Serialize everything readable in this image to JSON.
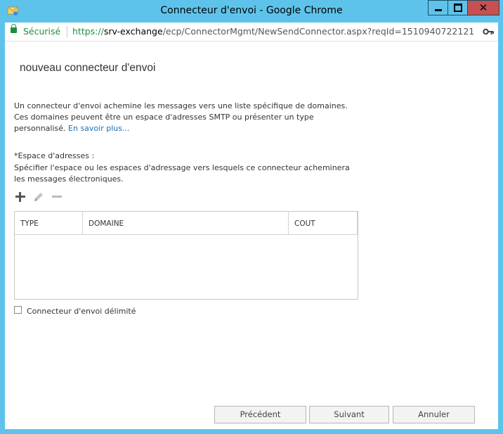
{
  "window": {
    "title": "Connecteur d'envoi - Google Chrome",
    "close_glyph": "✕"
  },
  "addressbar": {
    "secure_label": "Sécurisé",
    "url_protocol": "https://",
    "url_host": "srv-exchange",
    "url_path": "/ecp/ConnectorMgmt/NewSendConnector.aspx?reqId=1510940722121"
  },
  "page": {
    "title": "nouveau connecteur d'envoi",
    "description": "Un connecteur d'envoi achemine les messages vers une liste spécifique de domaines. Ces domaines peuvent être un espace d'adresses SMTP ou présenter un type personnalisé.",
    "learn_more": "En savoir plus...",
    "address_space_label": "*Espace d'adresses :",
    "address_space_help": "Spécifier l'espace ou les espaces d'adressage vers lesquels ce connecteur acheminera les messages électroniques."
  },
  "toolbar": {
    "icons": [
      "add-icon",
      "edit-icon",
      "remove-icon"
    ]
  },
  "grid": {
    "columns": [
      "TYPE",
      "DOMAINE",
      "COUT"
    ],
    "rows": []
  },
  "options": {
    "scoped_label": "Connecteur d'envoi délimité",
    "scoped_checked": false
  },
  "buttons": {
    "previous": "Précédent",
    "next": "Suivant",
    "cancel": "Annuler"
  },
  "colors": {
    "titlebar": "#5ec3ea",
    "close_button": "#c75050",
    "secure_green": "#1e8e3e",
    "link_blue": "#1a6fb5"
  }
}
